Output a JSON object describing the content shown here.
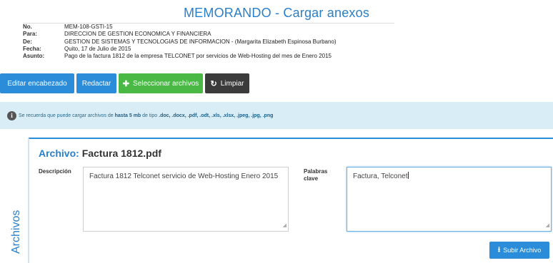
{
  "page": {
    "title": "MEMORANDO - Cargar anexos",
    "side_label": "Archivos"
  },
  "memo": {
    "rows": [
      {
        "label": "No.",
        "value": "MEM-108-GSTI-15"
      },
      {
        "label": "Para:",
        "value": "DIRECCION DE GESTION ECONOMICA Y FINANCIERA"
      },
      {
        "label": "De:",
        "value": "GESTION DE SISTEMAS Y TECNOLOGIAS DE INFORMACION - (Margarita Elizabeth Espinosa Burbano)"
      },
      {
        "label": "Fecha:",
        "value": "Quito, 17 de Julio de 2015"
      },
      {
        "label": "Asunto:",
        "value": "Pago de la factura 1812 de la empresa TELCONET por servicios de Web-Hosting del mes de Enero 2015"
      }
    ]
  },
  "toolbar": {
    "edit_header": "Editar encabezado",
    "redact": "Redactar",
    "select_files": "Seleccionar archivos",
    "clear": "Limpiar"
  },
  "alert": {
    "prefix": "Se recuerda que puede cargar archivos de ",
    "size": "hasta 5 mb",
    "middle": " de tipo ",
    "types": ".doc, .docx, .pdf, .odt, .xls, .xlsx, .jpeg, .jpg, .png"
  },
  "file": {
    "title_prefix": "Archivo:",
    "name": "Factura 1812.pdf",
    "description_label": "Descripción",
    "description_value": "Factura 1812 Telconet servicio de Web-Hosting Enero 2015",
    "keywords_label_1": "Palabras",
    "keywords_label_2": "clave",
    "keywords_value": "Factura, Telconet",
    "upload_label": "Subir Archivo"
  },
  "colors": {
    "accent": "#2b8cd9",
    "title": "#2a7fc9",
    "green": "#49b845",
    "dark": "#3b3b3b",
    "alert_bg": "#d8edf6"
  }
}
